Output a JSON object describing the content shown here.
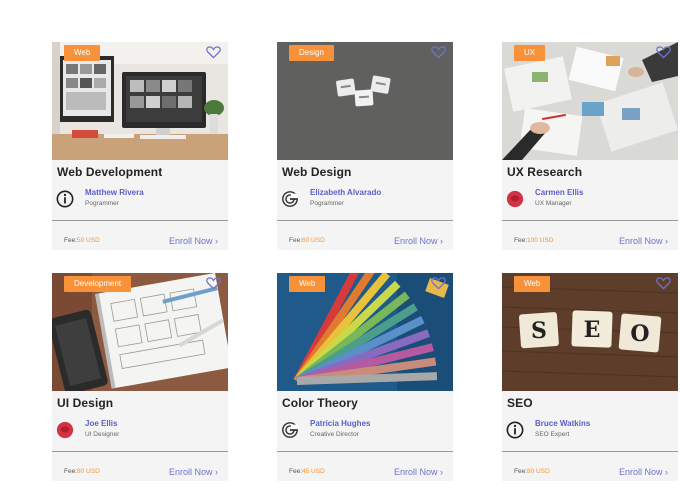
{
  "courses": [
    {
      "tag": "Web",
      "title": "Web Development",
      "instructor": "Matthew Rivera",
      "role": "Pogrammer",
      "icon": "info-circle-icon",
      "fee_label": "Fee:",
      "fee": "50 USD",
      "enroll": "Enroll Now ›"
    },
    {
      "tag": "Design",
      "title": "Web Design",
      "instructor": "Elizabeth Alvarado",
      "role": "Pogrammer",
      "icon": "g-logo-icon",
      "fee_label": "Fee:",
      "fee": "60 USD",
      "enroll": "Enroll Now ›"
    },
    {
      "tag": "UX",
      "title": "UX Research",
      "instructor": "Carmen Ellis",
      "role": "UX Manager",
      "icon": "red-blob-icon",
      "fee_label": "Fee:",
      "fee": "100 USD",
      "enroll": "Enroll Now ›"
    },
    {
      "tag": "Development",
      "title": "UI Design",
      "instructor": "Joe Ellis",
      "role": "UI Designer",
      "icon": "red-blob-icon",
      "fee_label": "Fee:",
      "fee": "80 USD",
      "enroll": "Enroll Now ›"
    },
    {
      "tag": "Web",
      "title": "Color Theory",
      "instructor": "Patricia Hughes",
      "role": "Creative Director",
      "icon": "g-logo-icon",
      "fee_label": "Fee:",
      "fee": "45 USD",
      "enroll": "Enroll Now ›"
    },
    {
      "tag": "Web",
      "title": "SEO",
      "instructor": "Bruce Watkins",
      "role": "SEO Expert",
      "icon": "info-circle-icon",
      "fee_label": "Fee:",
      "fee": "80 USD",
      "enroll": "Enroll Now ›"
    }
  ],
  "colors": {
    "tag": "#f7923a",
    "link": "#6f74c9",
    "name": "#5b5fc7"
  },
  "seo_tiles": [
    "S",
    "E",
    "O"
  ]
}
